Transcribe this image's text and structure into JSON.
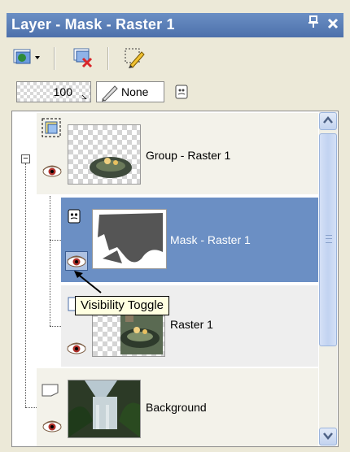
{
  "panel": {
    "title": "Layer - Mask - Raster 1",
    "pin_glyph": "ᵽ",
    "close_glyph": "✕"
  },
  "toolbar": {
    "buttons": [
      {
        "name": "new-layer-icon"
      },
      {
        "name": "delete-layer-icon"
      },
      {
        "name": "edit-selection-icon"
      }
    ]
  },
  "properties": {
    "opacity": "100",
    "blend_mode": "None"
  },
  "layers": [
    {
      "name": "Group - Raster 1",
      "type": "group",
      "visible": true
    },
    {
      "name": "Mask - Raster 1",
      "type": "mask",
      "visible": true,
      "selected": true
    },
    {
      "name": "Raster 1",
      "type": "raster",
      "visible": true
    },
    {
      "name": "Background",
      "type": "raster",
      "visible": true
    }
  ],
  "tooltip": "Visibility Toggle",
  "colors": {
    "titlebar": "#5a7fba",
    "selected_row": "#6b8fc4",
    "panel_bg": "#ece9d8"
  }
}
